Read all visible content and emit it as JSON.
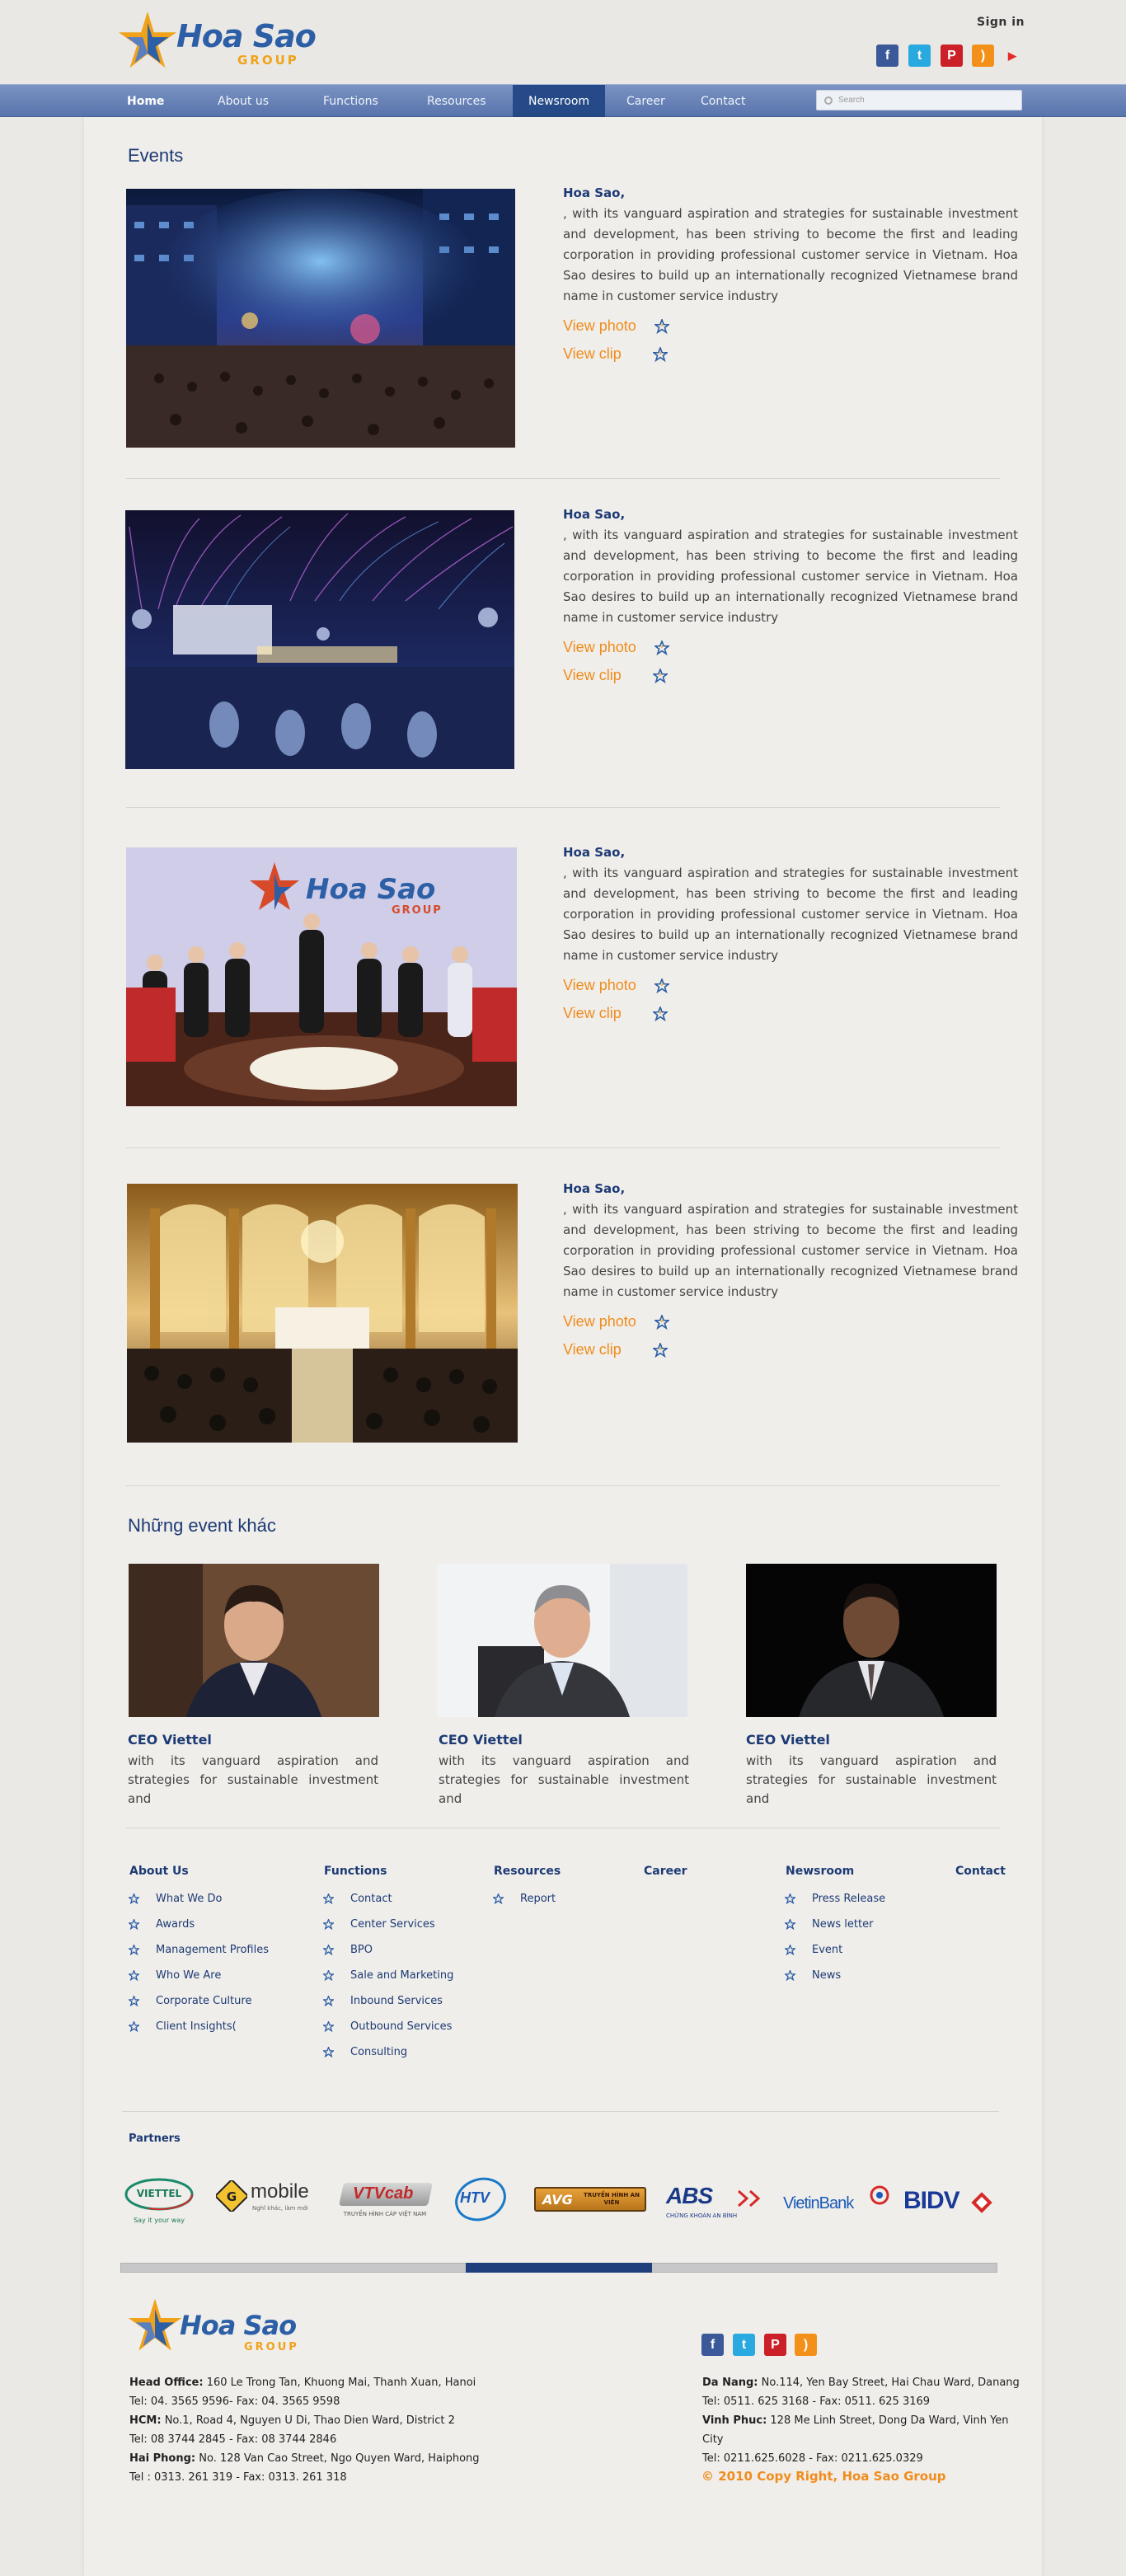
{
  "header": {
    "logo_text": "Hoa Sao",
    "logo_group": "GROUP",
    "signin": "Sign in",
    "social": [
      "facebook-icon",
      "twitter-icon",
      "pinterest-icon",
      "rss-icon",
      "youtube-icon"
    ]
  },
  "nav": {
    "items": [
      {
        "label": "Home"
      },
      {
        "label": "About us"
      },
      {
        "label": "Functions"
      },
      {
        "label": "Resources"
      },
      {
        "label": "Newsroom"
      },
      {
        "label": "Career"
      },
      {
        "label": "Contact"
      }
    ],
    "active": "Newsroom",
    "search_placeholder": "Search"
  },
  "events": {
    "heading": "Events",
    "items": [
      {
        "title": "Hoa Sao",
        "body": ", with its vanguard aspiration and strategies for sustainable investment and development, has been striving to become the first and leading corporation in providing professional customer service in Vietnam. Hoa Sao desires to build up an internationally recognized Vietnamese brand name in customer service industry",
        "photo_link": "View photo",
        "clip_link": "View clip"
      },
      {
        "title": "Hoa Sao",
        "body": ", with its vanguard aspiration and strategies for sustainable investment and development, has been striving to become the first and leading corporation in providing professional customer service in Vietnam. Hoa Sao desires to build up an internationally recognized Vietnamese brand name in customer service industry",
        "photo_link": "View photo",
        "clip_link": "View clip"
      },
      {
        "title": "Hoa Sao",
        "body": ", with its vanguard aspiration and strategies for sustainable investment and development, has been striving to become the first and leading corporation in providing professional customer service in Vietnam. Hoa Sao desires to build up an internationally recognized Vietnamese brand name in customer service industry",
        "photo_link": "View photo",
        "clip_link": "View clip"
      },
      {
        "title": "Hoa Sao",
        "body": ", with its vanguard aspiration and strategies for sustainable investment and development, has been striving to become the first and leading corporation in providing professional customer service in Vietnam. Hoa Sao desires to build up an internationally recognized Vietnamese brand name in customer service industry",
        "photo_link": "View photo",
        "clip_link": "View clip"
      }
    ]
  },
  "other_events": {
    "heading": "Những event khác",
    "items": [
      {
        "title": "CEO Viettel",
        "body": "with its vanguard aspiration and strategies for sustainable investment and"
      },
      {
        "title": "CEO Viettel",
        "body": "with its vanguard aspiration and strategies for sustainable investment and"
      },
      {
        "title": "CEO Viettel",
        "body": "with its vanguard aspiration and strategies for sustainable investment and"
      }
    ]
  },
  "footer_links": {
    "about": {
      "head": "About Us",
      "items": [
        "What We Do",
        "Awards",
        "Management Profiles",
        "Who We Are",
        "Corporate Culture",
        "Client Insights("
      ]
    },
    "functions": {
      "head": "Functions",
      "items": [
        "Contact",
        "Center Services",
        "BPO",
        "Sale and Marketing",
        "Inbound Services",
        "Outbound Services",
        "Consulting"
      ]
    },
    "resources": {
      "head": "Resources",
      "items": [
        "Report"
      ]
    },
    "career": {
      "head": "Career",
      "items": []
    },
    "newsroom": {
      "head": "Newsroom",
      "items": [
        "Press Release",
        "News letter",
        "Event",
        "News"
      ]
    },
    "contact": {
      "head": "Contact",
      "items": []
    }
  },
  "partners": {
    "label": "Partners",
    "logos": [
      {
        "name": "VIETTEL",
        "sub": "Say it your way"
      },
      {
        "name": "mobile",
        "sub": "Nghĩ khác, làm mới"
      },
      {
        "name": "VTVcab",
        "sub": "TRUYỀN HÌNH CÁP VIỆT NAM"
      },
      {
        "name": "HTV",
        "sub": ""
      },
      {
        "name": "AVG",
        "sub": "TRUYỀN HÌNH AN VIÊN"
      },
      {
        "name": "ABS",
        "sub": "CHỨNG KHOÁN AN BÌNH"
      },
      {
        "name": "VietinBank",
        "sub": ""
      },
      {
        "name": "BIDV",
        "sub": ""
      }
    ]
  },
  "footer": {
    "logo_text": "Hoa Sao",
    "logo_group": "GROUP",
    "left": [
      {
        "label": "Head Office:",
        "text": " 160 Le Trong Tan,  Khuong Mai, Thanh Xuan, Hanoi"
      },
      {
        "label": "",
        "text": "Tel: 04. 3565 9596- Fax: 04. 3565 9598"
      },
      {
        "label": "HCM:",
        "text": " No.1, Road 4, Nguyen U Di, Thao Dien Ward, District 2"
      },
      {
        "label": "",
        "text": "Tel: 08 3744 2845 - Fax: 08 3744 2846"
      },
      {
        "label": "Hai Phong:",
        "text": " No. 128 Van Cao Street, Ngo Quyen Ward, Haiphong"
      },
      {
        "label": "",
        "text": "Tel : 0313. 261 319 - Fax: 0313. 261 318"
      }
    ],
    "right": [
      {
        "label": "Da Nang:",
        "text": " No.114, Yen Bay Street, Hai Chau Ward, Danang"
      },
      {
        "label": "",
        "text": " Tel: 0511. 625 3168 - Fax: 0511. 625 3169"
      },
      {
        "label": "Vinh Phuc:",
        "text": " 128 Me Linh Street, Dong Da Ward, Vinh Yen City"
      },
      {
        "label": "",
        "text": "Tel: 0211.625.6028 - Fax: 0211.625.0329"
      }
    ],
    "copyright": "© 2010 Copy Right, Hoa Sao Group"
  },
  "colors": {
    "navy": "#1c3a75",
    "orange": "#f08c1d",
    "nav_active": "#264a87"
  }
}
